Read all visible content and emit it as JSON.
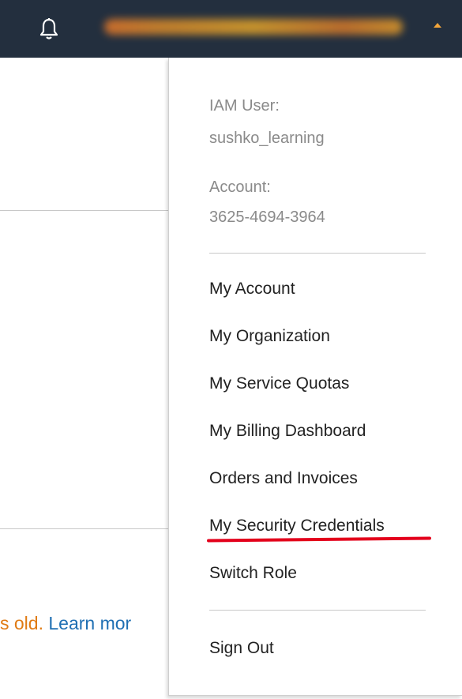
{
  "header": {
    "bell_icon": "bell-icon",
    "account_name": "",
    "caret_icon": "caret-up-icon",
    "colors": {
      "background": "#232f3e",
      "caret": "#f2a53b"
    }
  },
  "background_page": {
    "age_text": "s old.",
    "learn_more": "Learn mor"
  },
  "account_menu": {
    "iam_user_label": "IAM User:",
    "iam_user_value": "sushko_learning",
    "account_label": "Account:",
    "account_value": "3625-4694-3964",
    "items": [
      {
        "label": "My Account"
      },
      {
        "label": "My Organization"
      },
      {
        "label": "My Service Quotas"
      },
      {
        "label": "My Billing Dashboard"
      },
      {
        "label": "Orders and Invoices"
      },
      {
        "label": "My Security Credentials",
        "highlighted": true
      },
      {
        "label": "Switch Role"
      }
    ],
    "sign_out": "Sign Out",
    "highlight_color": "#e3001b"
  }
}
